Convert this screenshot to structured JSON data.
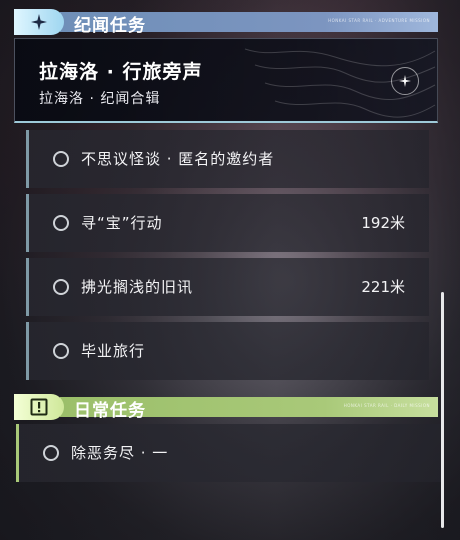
{
  "story_section": {
    "title": "纪闻任务",
    "tiny_text": "HONKAI STAR RAIL · ADVENTURE MISSION",
    "featured": {
      "title": "拉海洛 · 行旅旁声",
      "subtitle": "拉海洛 · 纪闻合辑",
      "icon": "star-emblem-icon"
    },
    "quests": [
      {
        "label": "不思议怪谈 · 匿名的邀约者",
        "distance": ""
      },
      {
        "label": "寻“宝”行动",
        "distance": "192米"
      },
      {
        "label": "拂光搁浅的旧讯",
        "distance": "221米"
      },
      {
        "label": "毕业旅行",
        "distance": ""
      }
    ]
  },
  "daily_section": {
    "title": "日常任务",
    "tiny_text": "HONKAI STAR RAIL · DAILY MISSION",
    "icon": "exclamation-icon",
    "quests": [
      {
        "label": "除恶务尽 · 一",
        "distance": ""
      }
    ]
  },
  "colors": {
    "story_accent": "#7c95c0",
    "daily_accent": "#a9c979",
    "story_row_border": "#7f9aa6"
  }
}
